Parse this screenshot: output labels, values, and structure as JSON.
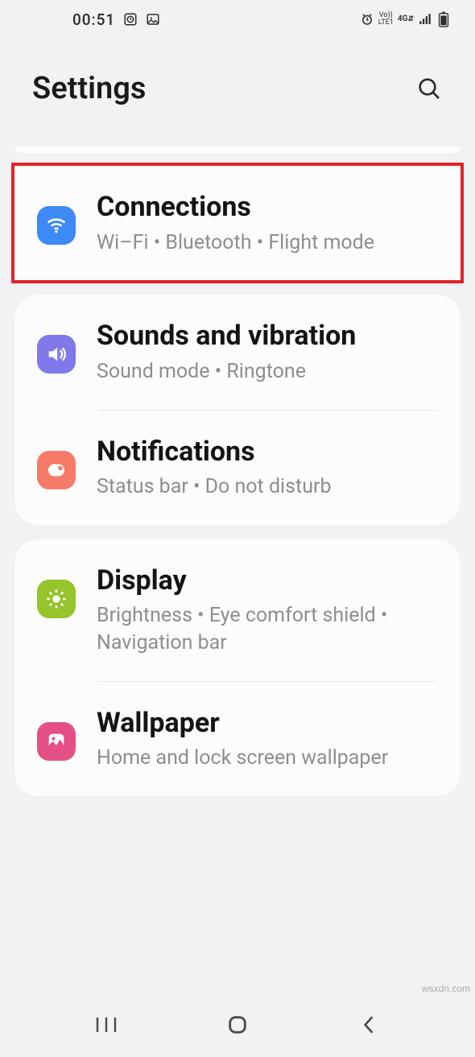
{
  "status": {
    "time": "00:51"
  },
  "header": {
    "title": "Settings"
  },
  "items": {
    "connections": {
      "title": "Connections",
      "sub": "Wi–Fi  •  Bluetooth  •  Flight mode"
    },
    "sounds": {
      "title": "Sounds and vibration",
      "sub": "Sound mode  •  Ringtone"
    },
    "notifications": {
      "title": "Notifications",
      "sub": "Status bar  •  Do not disturb"
    },
    "display": {
      "title": "Display",
      "sub": "Brightness  •  Eye comfort shield  •  Navigation bar"
    },
    "wallpaper": {
      "title": "Wallpaper",
      "sub": "Home and lock screen wallpaper"
    }
  },
  "watermark": "wsxdn.com"
}
